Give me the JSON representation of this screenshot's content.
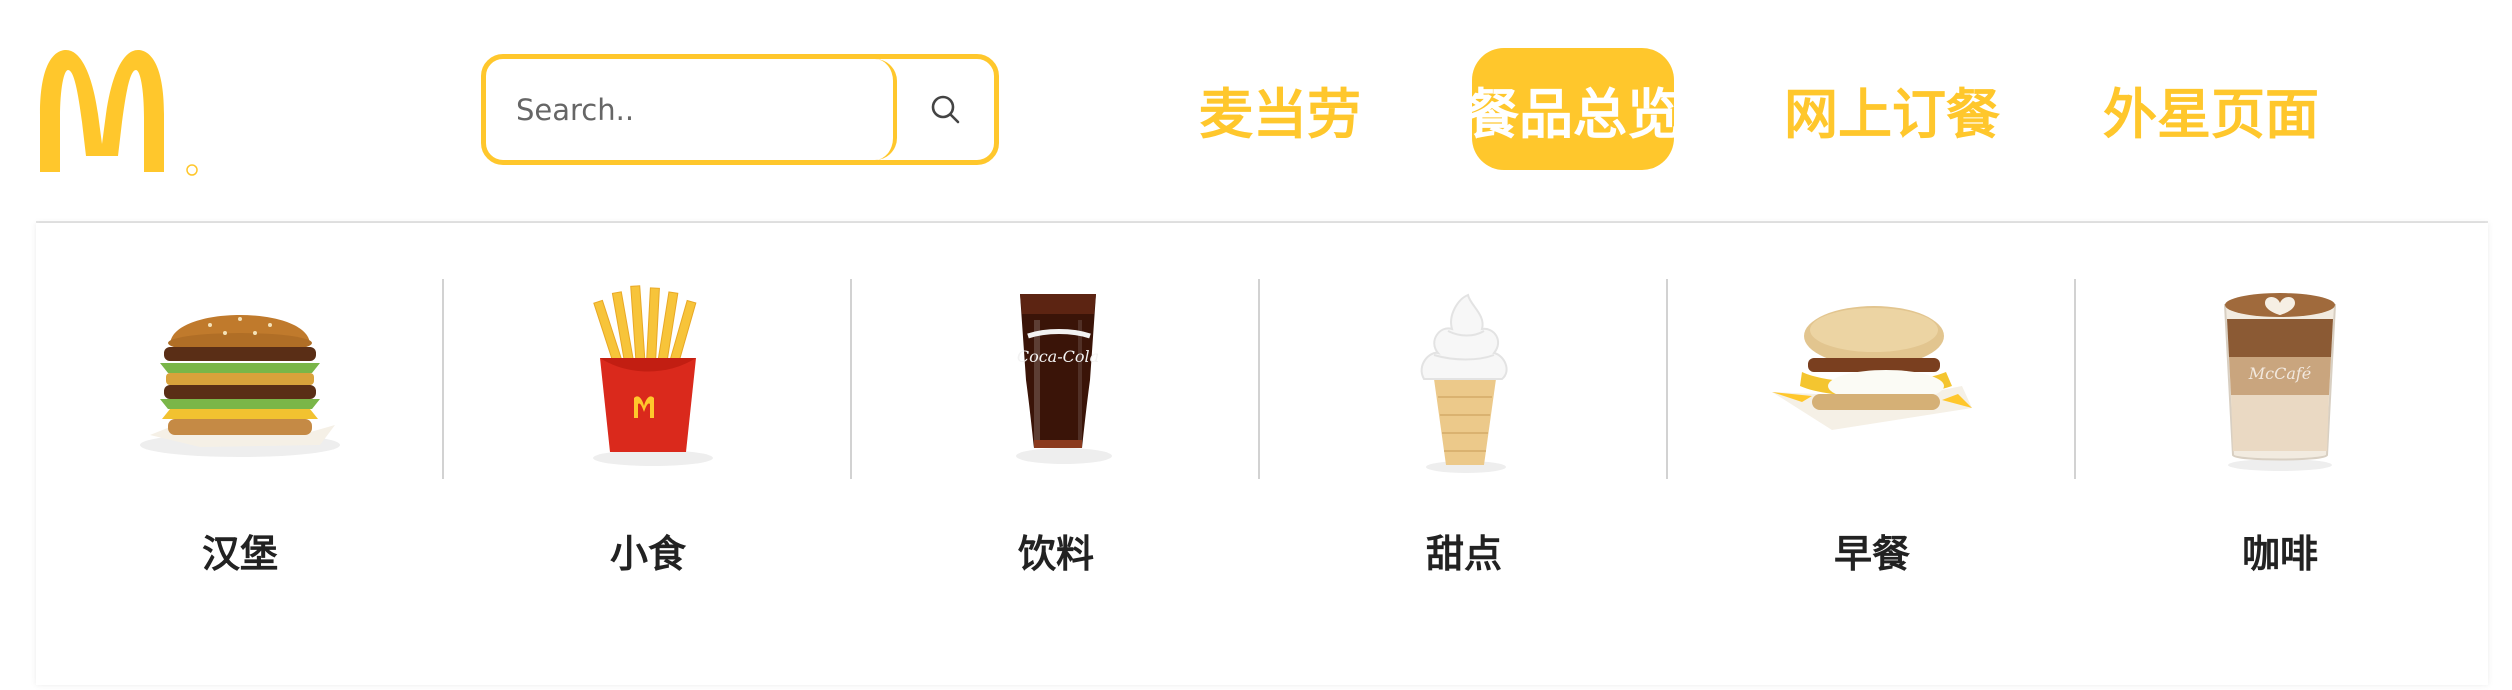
{
  "brand": {
    "logo_icon": "mcdonalds-golden-arches",
    "accent_color": "#FFC72C"
  },
  "search": {
    "placeholder": "Search..",
    "value": "",
    "icon": "search-icon"
  },
  "nav": {
    "items": [
      {
        "label": "麦当劳",
        "active": false
      },
      {
        "label": "餐品总览",
        "active": true
      },
      {
        "label": "网上订餐",
        "active": false
      },
      {
        "label": "外星页面",
        "active": false
      }
    ]
  },
  "menu": {
    "categories": [
      {
        "label": "汉堡",
        "icon": "burger-icon"
      },
      {
        "label": "小食",
        "icon": "fries-icon"
      },
      {
        "label": "饮料",
        "icon": "cola-icon"
      },
      {
        "label": "甜点",
        "icon": "ice-cream-cone-icon"
      },
      {
        "label": "早餐",
        "icon": "breakfast-muffin-icon"
      },
      {
        "label": "咖啡",
        "icon": "coffee-latte-icon"
      }
    ]
  }
}
